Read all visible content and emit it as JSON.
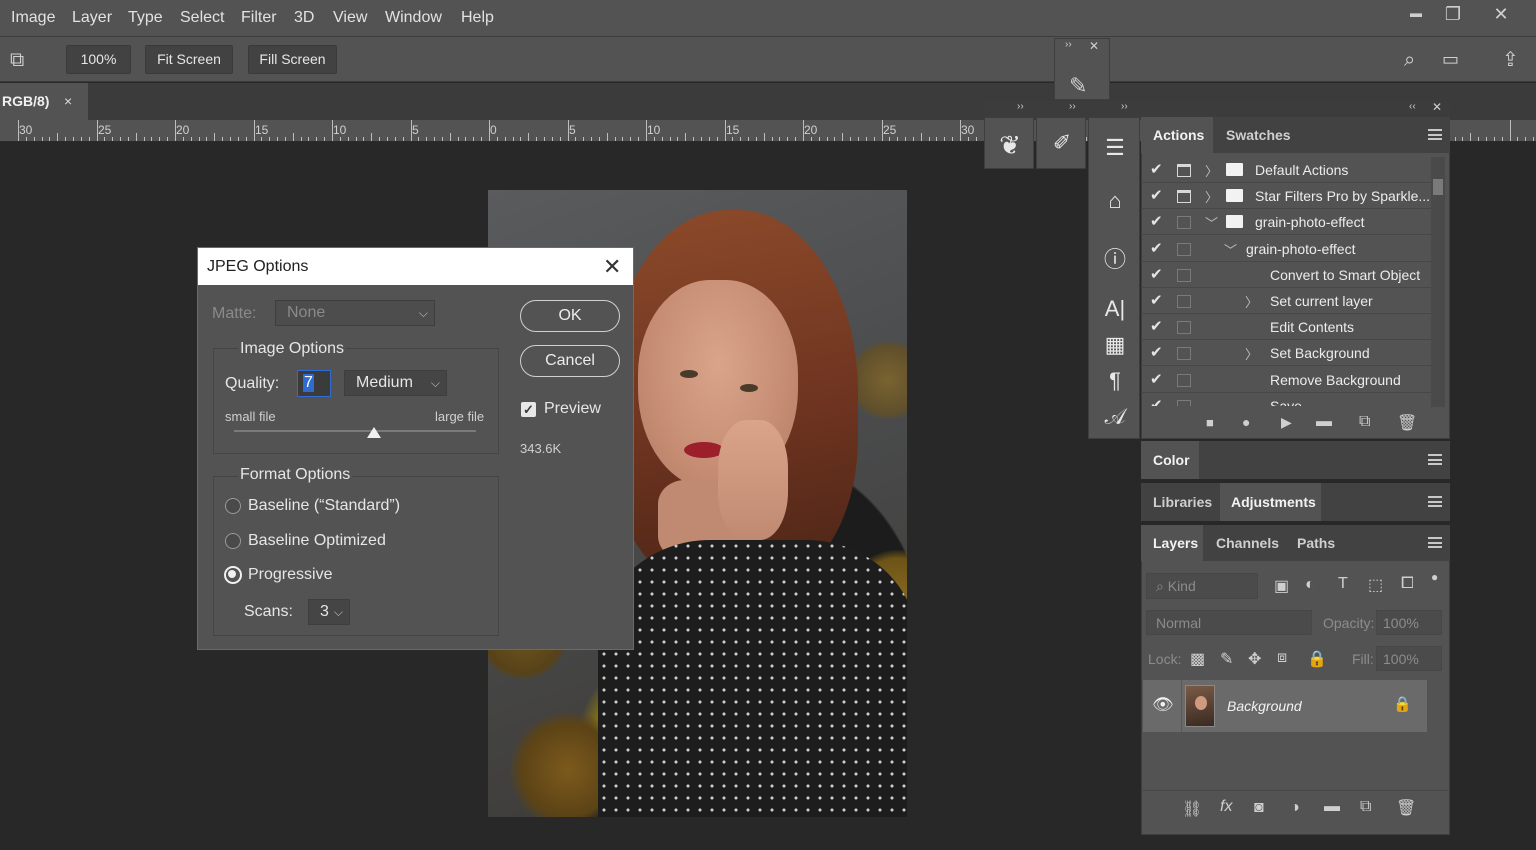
{
  "menubar": {
    "items": [
      "Image",
      "Layer",
      "Type",
      "Select",
      "Filter",
      "3D",
      "View",
      "Window",
      "Help"
    ],
    "minimize": "▬",
    "restore": "❐",
    "close": "✕"
  },
  "options_bar": {
    "zoom": "100%",
    "fit_screen": "Fit Screen",
    "fill_screen": "Fill Screen"
  },
  "document_tab": {
    "label": "RGB/8)",
    "close": "×"
  },
  "ruler": {
    "labels": [
      "30",
      "25",
      "20",
      "15",
      "10",
      "5",
      "0",
      "5",
      "10",
      "15",
      "20",
      "25",
      "30"
    ]
  },
  "dialog": {
    "title": "JPEG Options",
    "close": "✕",
    "matte_label": "Matte:",
    "matte_value": "None",
    "image_options_title": "Image Options",
    "quality_label": "Quality:",
    "quality_value": "7",
    "quality_preset": "Medium",
    "small_file": "small file",
    "large_file": "large file",
    "quality_slider_fraction": 0.58,
    "format_options_title": "Format Options",
    "formats": [
      "Baseline (“Standard”)",
      "Baseline Optimized",
      "Progressive"
    ],
    "selected_format": "Progressive",
    "scans_label": "Scans:",
    "scans_value": "3",
    "ok": "OK",
    "cancel": "Cancel",
    "preview_label": "Preview",
    "preview_checked": true,
    "file_size": "343.6K"
  },
  "actions_panel": {
    "tabs": [
      "Actions",
      "Swatches"
    ],
    "active_tab": "Actions",
    "rows": [
      {
        "label": "Default Actions",
        "type": "set"
      },
      {
        "label": "Star Filters Pro by Sparkle...",
        "type": "set"
      },
      {
        "label": "grain-photo-effect",
        "type": "set-open"
      },
      {
        "label": "grain-photo-effect",
        "type": "action-open"
      },
      {
        "label": "Convert to Smart Object",
        "type": "step"
      },
      {
        "label": "Set current layer",
        "type": "step-expandable"
      },
      {
        "label": "Edit Contents",
        "type": "step"
      },
      {
        "label": "Set Background",
        "type": "step-expandable"
      },
      {
        "label": "Remove Background",
        "type": "step"
      },
      {
        "label": "Save",
        "type": "step"
      }
    ]
  },
  "color_panel": {
    "tab": "Color"
  },
  "adjustments_panel": {
    "tabs": [
      "Libraries",
      "Adjustments"
    ],
    "active_tab": "Adjustments"
  },
  "layers_panel": {
    "tabs": [
      "Layers",
      "Channels",
      "Paths"
    ],
    "active_tab": "Layers",
    "kind_placeholder": "Kind",
    "blend_mode": "Normal",
    "opacity_label": "Opacity:",
    "opacity_value": "100%",
    "lock_label": "Lock:",
    "fill_label": "Fill:",
    "fill_value": "100%",
    "layers": [
      {
        "name": "Background",
        "visible": true,
        "locked": true
      }
    ]
  },
  "colors": {
    "menubar": "#535353",
    "canvas_bg": "#282828",
    "dialog_bg": "#535353",
    "panel_bg": "#535353"
  }
}
